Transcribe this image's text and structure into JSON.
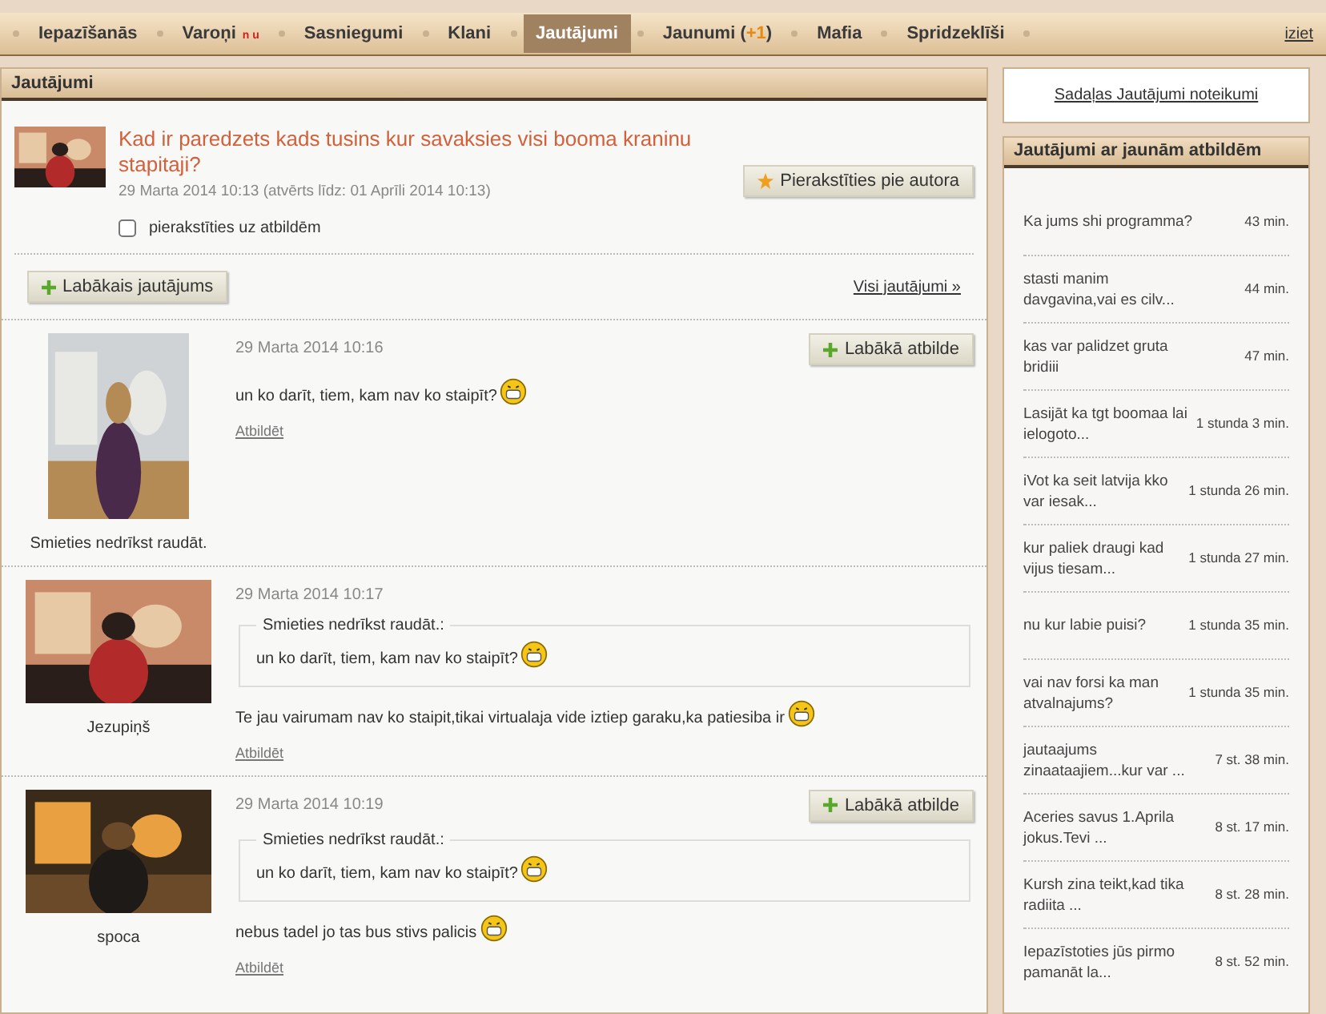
{
  "nav": {
    "items": [
      {
        "label": "Iepazīšanās",
        "selected": false
      },
      {
        "label": "Varoņi",
        "badge": "n u",
        "selected": false
      },
      {
        "label": "Sasniegumi",
        "selected": false
      },
      {
        "label": "Klani",
        "selected": false
      },
      {
        "label": "Jautājumi",
        "selected": true
      },
      {
        "label": "Jaunumi (",
        "count": "+1",
        "suffix": ")",
        "selected": false
      },
      {
        "label": "Mafia",
        "selected": false
      },
      {
        "label": "Spridzeklīši",
        "selected": false
      }
    ],
    "logout": "iziet"
  },
  "main": {
    "header": "Jautājumi",
    "question": {
      "title": "Kad ir paredzets kads tusins kur savaksies visi booma kraninu stapitaji?",
      "meta": "29 Marta 2014 10:13 (atvērts līdz: 01 Aprīli 2014 10:13)",
      "subscribe_author": "Pierakstīties pie autora",
      "subscribe_answers": {
        "label": "pierakstīties uz atbildēm",
        "checked": false
      }
    },
    "best_question": "Labākais jautājums",
    "all_questions": "Visi jautājumi »",
    "posts": [
      {
        "kind": "plain",
        "author": "Smieties nedrīkst raudāt.",
        "date": "29 Marta 2014 10:16",
        "best_answer": "Labākā atbilde",
        "text": "un ko darīt, tiem, kam nav ko staipīt?",
        "reply": "Atbildēt"
      },
      {
        "kind": "quote",
        "author": "Jezupiņš",
        "date": "29 Marta 2014 10:17",
        "quote_author": "Smieties nedrīkst raudāt.:",
        "quote_text": "un ko darīt, tiem, kam nav ko staipīt?",
        "text": "Te jau vairumam nav ko staipit,tikai virtualaja vide iztiep garaku,ka patiesiba ir",
        "reply": "Atbildēt"
      },
      {
        "kind": "quote",
        "author": "spoca",
        "date": "29 Marta 2014 10:19",
        "best_answer": "Labākā atbilde",
        "quote_author": "Smieties nedrīkst raudāt.:",
        "quote_text": "un ko darīt, tiem, kam nav ko staipīt?",
        "text": "nebus tadel jo tas bus stivs palicis",
        "reply": "Atbildēt"
      }
    ]
  },
  "sidebar": {
    "rules_link": "Sadaļas Jautājumi noteikumi",
    "header": "Jautājumi ar jaunām atbildēm",
    "items": [
      {
        "title": "Ka jums shi programma?",
        "time": "43 min."
      },
      {
        "title": "stasti manim davgavina,vai es cilv...",
        "time": "44 min."
      },
      {
        "title": "kas var palidzet gruta bridiii",
        "time": "47 min."
      },
      {
        "title": "Lasijāt ka tgt boomaa lai ielogoto...",
        "time": "1 stunda 3 min."
      },
      {
        "title": "iVot ka seit latvija kko var iesak...",
        "time": "1 stunda 26 min."
      },
      {
        "title": "kur paliek draugi kad vijus tiesam...",
        "time": "1 stunda 27 min."
      },
      {
        "title": "nu kur labie puisi?",
        "time": "1 stunda 35 min."
      },
      {
        "title": "vai nav forsi ka man atvalnajums?",
        "time": "1 stunda 35 min."
      },
      {
        "title": "jautaajums zinaataajiem...kur var ...",
        "time": "7 st. 38 min."
      },
      {
        "title": "Aceries savus 1.Aprila jokus.Tevi ...",
        "time": "8 st. 17 min."
      },
      {
        "title": "Kursh zina teikt,kad tika radiita ...",
        "time": "8 st. 28 min."
      },
      {
        "title": "Iepazīstoties jūs pirmo pamanāt la...",
        "time": "8 st. 52 min."
      }
    ]
  }
}
